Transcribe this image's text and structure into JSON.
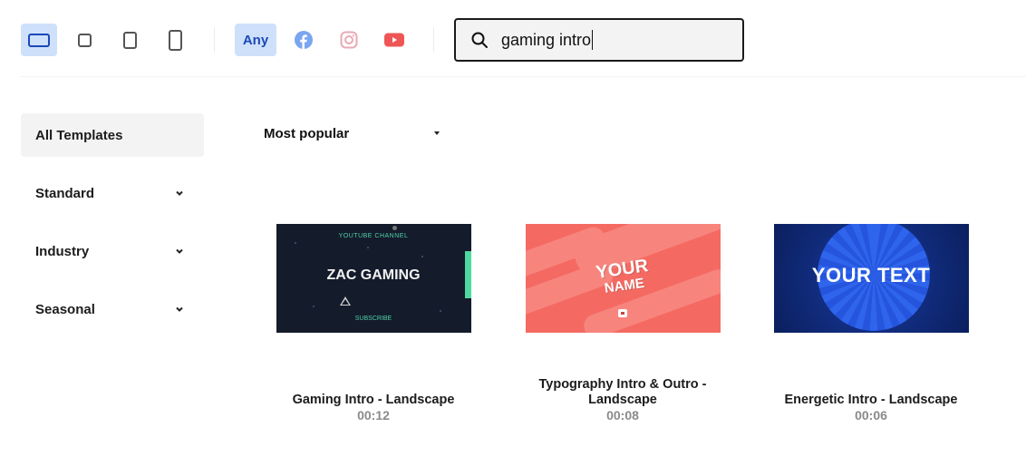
{
  "toolbar": {
    "formats": [
      {
        "name": "landscape",
        "active": true
      },
      {
        "name": "square",
        "active": false
      },
      {
        "name": "portrait",
        "active": false
      },
      {
        "name": "vertical",
        "active": false
      }
    ],
    "platforms": [
      {
        "name": "any",
        "label": "Any",
        "active": true
      },
      {
        "name": "facebook",
        "icon": "facebook-icon",
        "color": "#7aa5f0"
      },
      {
        "name": "instagram",
        "icon": "instagram-icon",
        "color": "#e9a9b6"
      },
      {
        "name": "youtube",
        "icon": "youtube-icon",
        "color": "#ee5656"
      }
    ],
    "search": {
      "value": "gaming intro",
      "placeholder": ""
    }
  },
  "sidebar": {
    "items": [
      {
        "label": "All Templates",
        "active": true,
        "expandable": false
      },
      {
        "label": "Standard",
        "active": false,
        "expandable": true
      },
      {
        "label": "Industry",
        "active": false,
        "expandable": true
      },
      {
        "label": "Seasonal",
        "active": false,
        "expandable": true
      }
    ]
  },
  "sort": {
    "selected": "Most popular"
  },
  "templates": [
    {
      "title": "Gaming Intro - Landscape",
      "duration": "00:12",
      "thumb": {
        "top_text": "YOUTUBE CHANNEL",
        "main_text": "ZAC GAMING",
        "bottom_text": "SUBSCRIBE"
      }
    },
    {
      "title": "Typography Intro & Outro - Landscape",
      "duration": "00:08",
      "thumb": {
        "line1": "YOUR",
        "line2": "NAME"
      }
    },
    {
      "title": "Energetic Intro - Landscape",
      "duration": "00:06",
      "thumb": {
        "main_text": "YOUR TEXT"
      }
    }
  ],
  "colors": {
    "accent": "#1a49b8",
    "accent_bg": "#cfe0fb",
    "active_bg": "#f3f3f3"
  }
}
